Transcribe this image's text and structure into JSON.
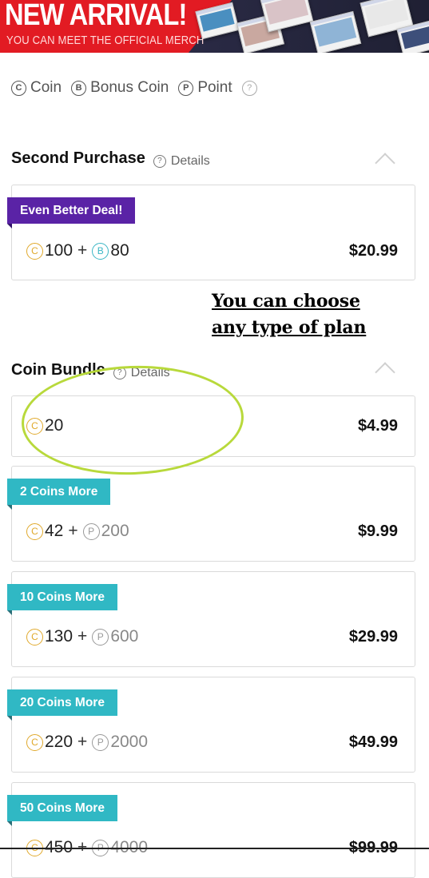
{
  "banner": {
    "title": "NEW ARRIVAL!",
    "subtitle": "YOU CAN MEET THE OFFICIAL MERCH"
  },
  "legend": {
    "coin": {
      "symbol": "C",
      "label": "Coin"
    },
    "bonus": {
      "symbol": "B",
      "label": "Bonus Coin"
    },
    "point": {
      "symbol": "P",
      "label": "Point"
    },
    "help_symbol": "?"
  },
  "annotation": {
    "line1": "You can choose ",
    "line2": "any type of plan"
  },
  "sections": {
    "second_purchase": {
      "title": "Second Purchase",
      "details_label": "Details",
      "cards": [
        {
          "tag": "Even Better Deal!",
          "coins": "100",
          "bonus": "80",
          "price": "$20.99"
        }
      ]
    },
    "coin_bundle": {
      "title": "Coin Bundle",
      "details_label": "Details",
      "cards": [
        {
          "tag": "",
          "coins": "20",
          "price": "$4.99"
        },
        {
          "tag": "2 Coins More",
          "coins": "42",
          "points": "200",
          "price": "$9.99"
        },
        {
          "tag": "10 Coins More",
          "coins": "130",
          "points": "600",
          "price": "$29.99"
        },
        {
          "tag": "20 Coins More",
          "coins": "220",
          "points": "2000",
          "price": "$49.99"
        },
        {
          "tag": "50 Coins More",
          "coins": "450",
          "points": "4000",
          "price": "$99.99"
        }
      ]
    }
  },
  "colors": {
    "banner_red": "#e21b23",
    "tag_purple": "#5a23a6",
    "tag_teal": "#30b8c4",
    "coin_gold": "#e0a92c",
    "bonus_teal": "#3bb6c5",
    "annotation_oval": "#b8d93b"
  }
}
